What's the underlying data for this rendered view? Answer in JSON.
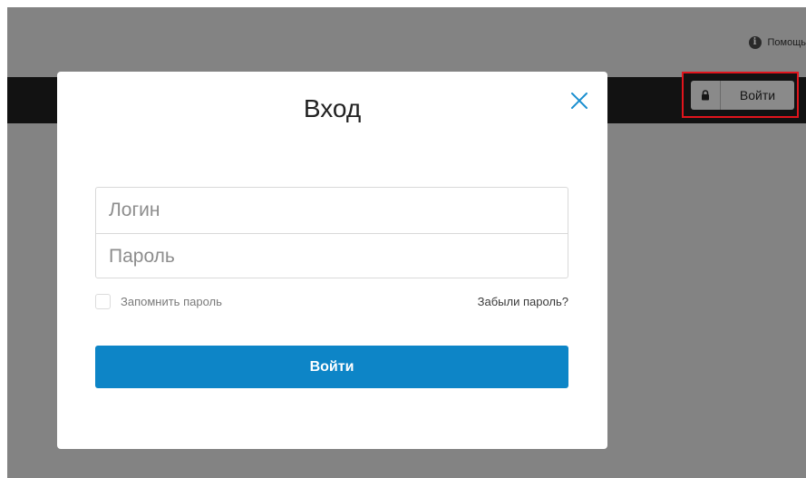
{
  "header": {
    "help_label": "Помощь",
    "login_button_label": "Войти"
  },
  "modal": {
    "title": "Вход",
    "login_placeholder": "Логин",
    "password_placeholder": "Пароль",
    "remember_label": "Запомнить пароль",
    "forgot_link": "Забыли пароль?",
    "submit_label": "Войти"
  },
  "icons": {
    "help": "info-circle-icon",
    "lock": "lock-icon",
    "close": "close-icon"
  },
  "colors": {
    "accent": "#0d85c7",
    "highlight_border": "#e1141c",
    "overlay": "#838383",
    "navbar": "#121212"
  }
}
